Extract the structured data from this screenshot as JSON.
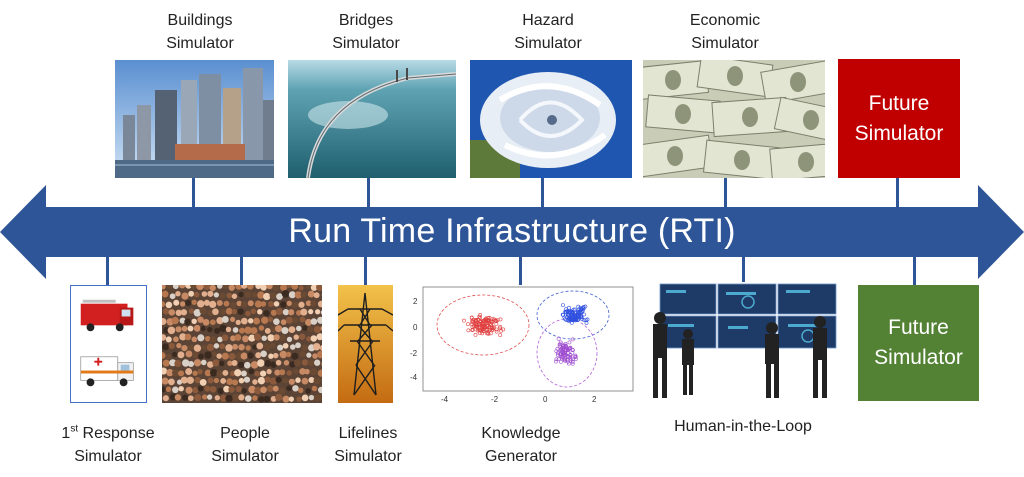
{
  "rti": {
    "title": "Run Time Infrastructure (RTI)"
  },
  "top_simulators": [
    {
      "line1": "Buildings",
      "line2": "Simulator"
    },
    {
      "line1": "Bridges",
      "line2": "Simulator"
    },
    {
      "line1": "Hazard",
      "line2": "Simulator"
    },
    {
      "line1": "Economic",
      "line2": "Simulator"
    }
  ],
  "bottom_simulators": [
    {
      "line1_main": "1",
      "line1_sup": "st",
      "line1_rest": " Response",
      "line2": "Simulator"
    },
    {
      "line1": "People",
      "line2": "Simulator"
    },
    {
      "line1": "Lifelines",
      "line2": "Simulator"
    },
    {
      "line1": "Knowledge",
      "line2": "Generator"
    },
    {
      "line1": "Human-in-the-Loop"
    }
  ],
  "future_top": {
    "line1": "Future",
    "line2": "Simulator",
    "color": "#c00000"
  },
  "future_bottom": {
    "line1": "Future",
    "line2": "Simulator",
    "color": "#548235"
  },
  "knowledge_plot": {
    "x_ticks": [
      "-4",
      "-2",
      "0",
      "2"
    ],
    "y_ticks": [
      "2",
      "0",
      "-2",
      "-4"
    ]
  },
  "colors": {
    "arrow": "#2e5597",
    "connector": "#2e5597"
  },
  "icons": [
    "fire-truck-icon",
    "ambulance-icon",
    "transmission-tower-icon",
    "hurricane-icon",
    "money-icon",
    "skyline-icon",
    "bridge-icon",
    "crowd-icon",
    "control-room-icon"
  ]
}
